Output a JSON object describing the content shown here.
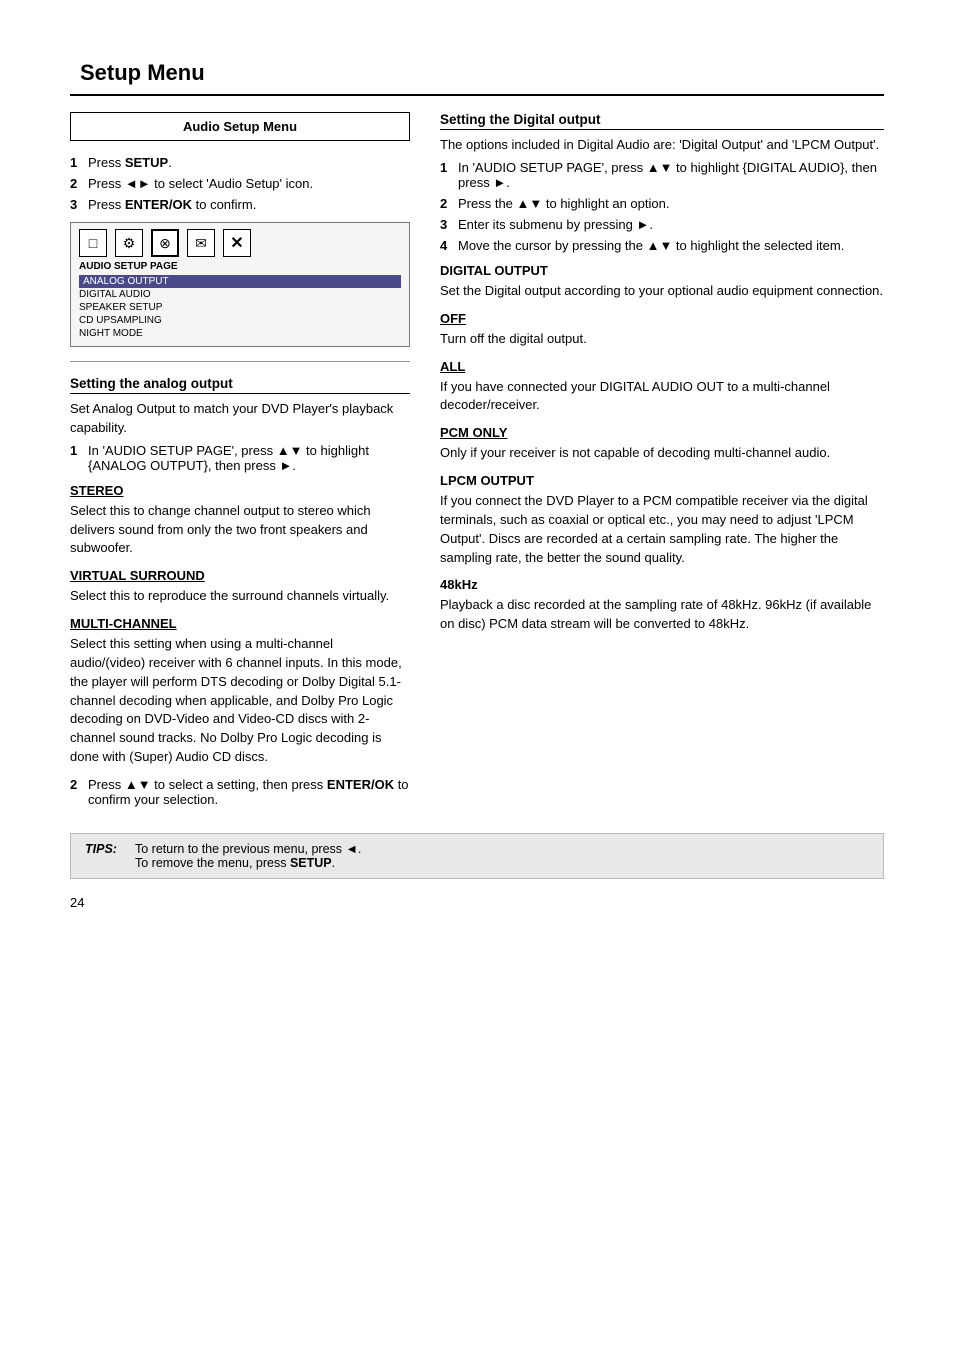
{
  "page": {
    "title": "Setup Menu",
    "page_number": "24"
  },
  "left_col": {
    "audio_setup_box": {
      "title": "Audio Setup Menu",
      "steps": [
        {
          "num": "1",
          "text": "Press ",
          "bold": "SETUP",
          "suffix": "."
        },
        {
          "num": "2",
          "text": "Press ◄► to select 'Audio Setup' icon."
        },
        {
          "num": "3",
          "text": "Press ",
          "bold": "ENTER/OK",
          "suffix": " to confirm."
        }
      ],
      "diagram": {
        "label": "AUDIO SETUP PAGE",
        "menu_items": [
          {
            "text": "ANALOG OUTPUT",
            "highlighted": true
          },
          {
            "text": "DIGITAL AUDIO"
          },
          {
            "text": "SPEAKER SETUP"
          },
          {
            "text": "CD UPSAMPLING"
          },
          {
            "text": "NIGHT MODE"
          }
        ]
      }
    },
    "analog_section": {
      "title": "Setting the analog output",
      "intro": "Set Analog Output to match your DVD Player's playback capability.",
      "step1": {
        "num": "1",
        "text": "In 'AUDIO SETUP PAGE', press ▲▼ to highlight {ANALOG OUTPUT}, then press ►."
      },
      "stereo": {
        "heading": "STEREO",
        "text": "Select this to change channel output to stereo which delivers sound from only the two front speakers and subwoofer."
      },
      "virtual_surround": {
        "heading": "VIRTUAL SURROUND",
        "text": "Select this to reproduce the surround channels virtually."
      },
      "multi_channel": {
        "heading": "MULTI-CHANNEL",
        "text": "Select this setting when using a multi-channel audio/(video) receiver with 6 channel inputs. In this mode, the player will perform DTS decoding or Dolby Digital 5.1-channel decoding when applicable, and Dolby Pro Logic decoding on DVD-Video and Video-CD discs with 2-channel sound tracks. No Dolby Pro Logic decoding is done with (Super) Audio CD discs."
      },
      "step2": {
        "num": "2",
        "text": "Press ▲▼ to select a setting, then press ",
        "bold": "ENTER/OK",
        "suffix": " to confirm your selection."
      }
    }
  },
  "right_col": {
    "digital_section": {
      "title": "Setting the Digital output",
      "intro": "The options included in Digital Audio are: 'Digital Output' and 'LPCM Output'.",
      "steps": [
        {
          "num": "1",
          "text": "In 'AUDIO SETUP PAGE', press ▲▼ to highlight {DIGITAL AUDIO}, then press ►."
        },
        {
          "num": "2",
          "text": "Press the ▲▼ to highlight an option."
        },
        {
          "num": "3",
          "text": "Enter its submenu by pressing ►."
        },
        {
          "num": "4",
          "text": "Move the cursor by pressing the ▲▼ to highlight the selected item."
        }
      ],
      "digital_output": {
        "heading": "DIGITAL OUTPUT",
        "intro": "Set the Digital output according to your optional audio equipment connection.",
        "off": {
          "heading": "OFF",
          "text": "Turn off the digital output."
        },
        "all": {
          "heading": "ALL",
          "text": "If you have connected your DIGITAL AUDIO OUT to a multi-channel decoder/receiver."
        },
        "pcm_only": {
          "heading": "PCM ONLY",
          "text": "Only if your receiver is not capable of decoding multi-channel audio."
        }
      },
      "lpcm_output": {
        "heading": "LPCM OUTPUT",
        "text": "If you connect the DVD Player to a PCM compatible receiver via the digital terminals, such as coaxial or optical etc., you may need to adjust 'LPCM Output'. Discs are recorded at a certain sampling rate. The higher the sampling rate, the better the sound quality."
      },
      "khz48": {
        "heading": "48kHz",
        "text": "Playback a disc recorded at the sampling rate of 48kHz. 96kHz (if available on disc) PCM data stream will be converted to 48kHz."
      }
    }
  },
  "tips": {
    "label": "TIPS:",
    "lines": [
      "To return to the previous menu, press ◄.",
      "To remove the menu, press SETUP."
    ]
  },
  "icons": {
    "page_icon": "□",
    "settings_icon": "⚙",
    "globe_icon": "⊗",
    "mail_icon": "✉",
    "close_icon": "✕"
  }
}
